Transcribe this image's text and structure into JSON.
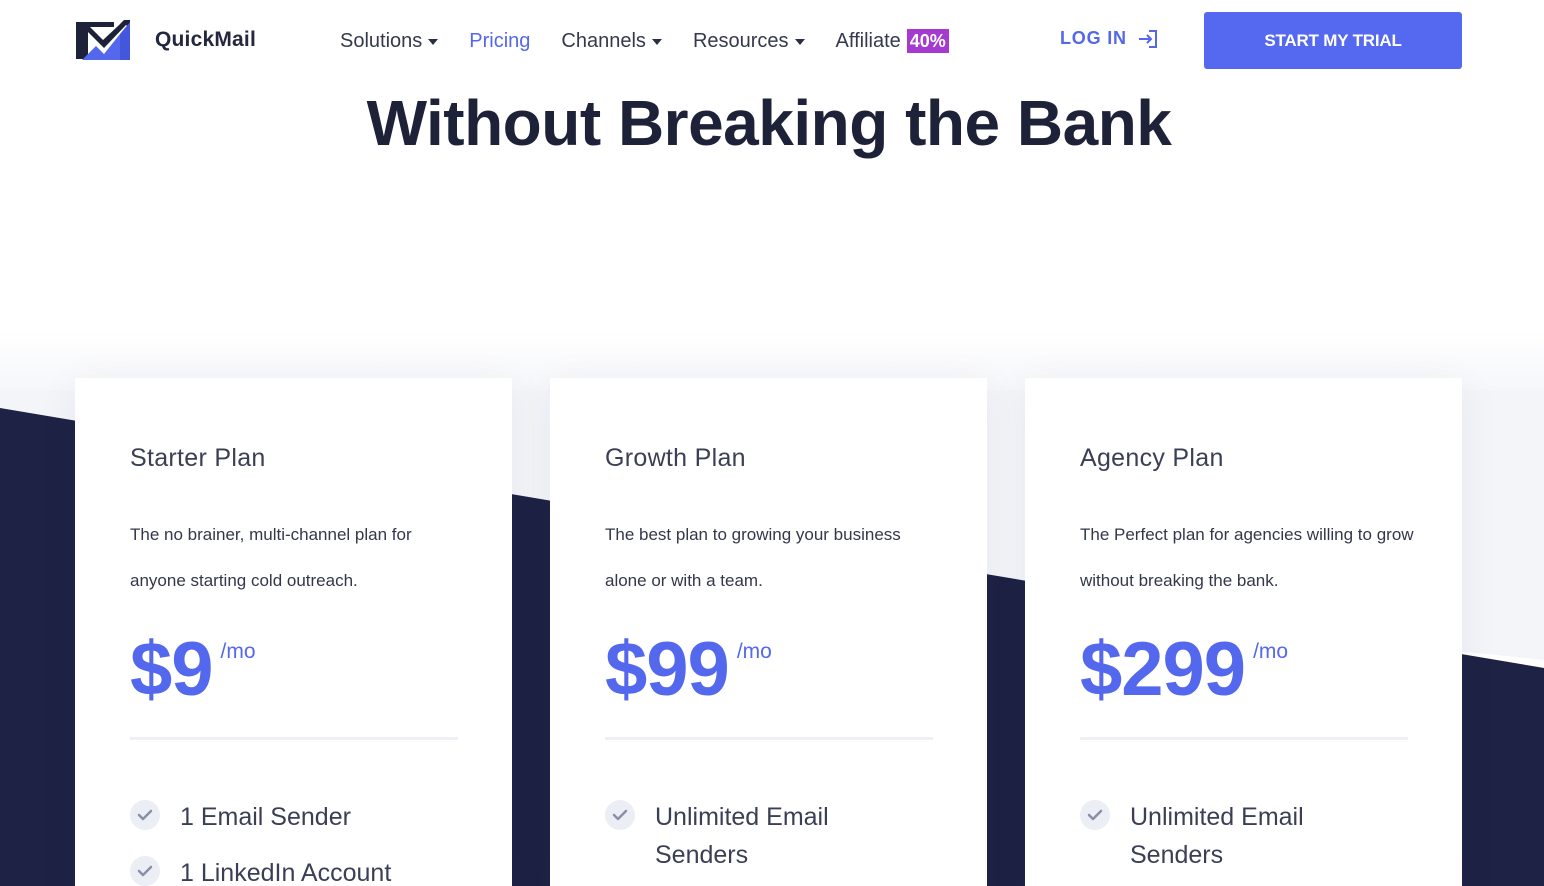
{
  "brand": {
    "name": "QuickMail",
    "logo_icon": "envelope-chart-icon"
  },
  "nav": {
    "items": [
      {
        "label": "Solutions",
        "has_dropdown": true,
        "active": false
      },
      {
        "label": "Pricing",
        "has_dropdown": false,
        "active": true
      },
      {
        "label": "Channels",
        "has_dropdown": true,
        "active": false
      },
      {
        "label": "Resources",
        "has_dropdown": true,
        "active": false
      },
      {
        "label": "Affiliate",
        "has_dropdown": false,
        "active": false,
        "badge": "40%"
      }
    ],
    "login_label": "LOG IN",
    "login_icon": "sign-in-icon",
    "cta_label": "START MY TRIAL"
  },
  "headline": "Without Breaking the Bank",
  "plans": [
    {
      "name": "Starter Plan",
      "description": "The no brainer, multi-channel plan for anyone starting cold outreach.",
      "price": "$9",
      "period": "/mo",
      "features": [
        "1 Email Sender",
        "1 LinkedIn Account"
      ]
    },
    {
      "name": "Growth Plan",
      "description": "The best plan to growing your business alone or with a team.",
      "price": "$99",
      "period": "/mo",
      "features": [
        "Unlimited Email Senders"
      ]
    },
    {
      "name": "Agency Plan",
      "description": "The Perfect plan for agencies willing to grow without breaking the bank.",
      "price": "$299",
      "period": "/mo",
      "features": [
        "Unlimited Email Senders"
      ]
    }
  ],
  "colors": {
    "accent": "#5468ee",
    "dark_navy": "#1e2244",
    "badge": "#a43ad0",
    "text": "#3a3f55"
  }
}
